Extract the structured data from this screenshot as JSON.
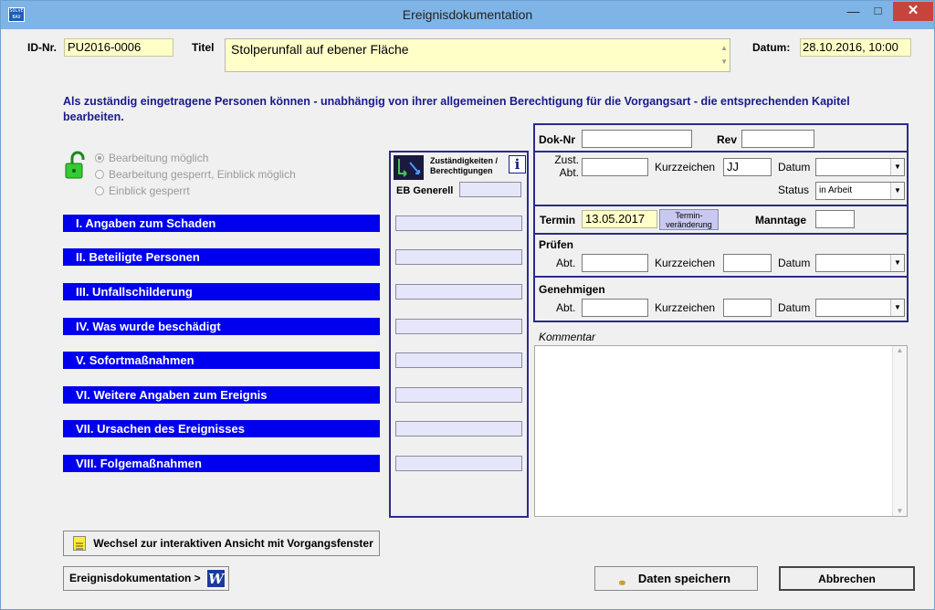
{
  "window": {
    "title": "Ereignisdokumentation",
    "minimize": "—",
    "maximize": "□",
    "close": "✕",
    "app_icon_text": "SOLVE BAU"
  },
  "header": {
    "id_label": "ID-Nr.",
    "id_value": "PU2016-0006",
    "titel_label": "Titel",
    "titel_value": "Stolperunfall auf ebener Fläche",
    "datum_label": "Datum:",
    "datum_value": "28.10.2016, 10:00"
  },
  "info_text": "Als zuständig eingetragene Personen können - unabhängig von ihrer allgemeinen Berechtigung für die Vorgangsart - die entsprechenden Kapitel bearbeiten.",
  "radios": {
    "opt1": "Bearbeitung möglich",
    "opt2": "Bearbeitung gesperrt, Einblick möglich",
    "opt3": "Einblick gesperrt"
  },
  "sections": [
    {
      "label": "I.  Angaben zum Schaden"
    },
    {
      "label": "II.  Beteiligte Personen"
    },
    {
      "label": "III.  Unfallschilderung"
    },
    {
      "label": "IV.  Was wurde beschädigt"
    },
    {
      "label": "V.  Sofortmaßnahmen"
    },
    {
      "label": "VI.  Weitere Angaben zum Ereignis"
    },
    {
      "label": "VII.  Ursachen des Ereignisses"
    },
    {
      "label": "VIII.  Folgemaßnahmen"
    }
  ],
  "zust_panel": {
    "header": "Zuständigkeiten / Berechtigungen",
    "info_icon": "i",
    "eb_label": "EB Generell"
  },
  "doc": {
    "doknr_label": "Dok-Nr",
    "rev_label": "Rev",
    "zust_abt_label": "Zust. Abt.",
    "kurzzeichen_label": "Kurzzeichen",
    "kurzzeichen_value": "JJ",
    "datum_label": "Datum",
    "status_label": "Status",
    "status_value": "in Arbeit",
    "termin_label": "Termin",
    "termin_value": "13.05.2017",
    "termin_btn": "Termin-veränderung",
    "manntage_label": "Manntage",
    "pruefen_label": "Prüfen",
    "abt_label": "Abt.",
    "genehmigen_label": "Genehmigen",
    "kommentar_label": "Kommentar"
  },
  "buttons": {
    "wechsel": "Wechsel zur interaktiven Ansicht mit Vorgangsfenster",
    "ereignis": "Ereignisdokumentation  >",
    "speichern": "Daten speichern",
    "abbrechen": "Abbrechen"
  },
  "colors": {
    "section_blue": "#0000ee",
    "field_yellow": "#ffffc8",
    "lavender": "#e6e6fa",
    "frame_navy": "#2b2b8c",
    "info_text": "#1a1a8c"
  }
}
